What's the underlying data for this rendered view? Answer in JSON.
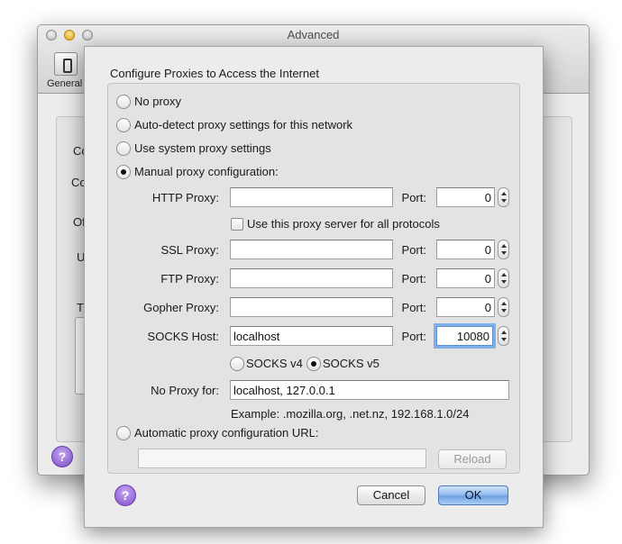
{
  "background_window": {
    "title": "Advanced",
    "toolbar_item_label": "General",
    "fragments": [
      "Co",
      "Co",
      "Of",
      "U",
      "T"
    ],
    "help_glyph": "?"
  },
  "dialog": {
    "title": "Configure Proxies to Access the Internet",
    "options": {
      "no_proxy": "No proxy",
      "auto_detect": "Auto-detect proxy settings for this network",
      "system": "Use system proxy settings",
      "manual": "Manual proxy configuration:",
      "auto_url": "Automatic proxy configuration URL:"
    },
    "selected_option": "manual",
    "http": {
      "label": "HTTP Proxy:",
      "value": "",
      "port_label": "Port:",
      "port": "0"
    },
    "use_for_all_label": "Use this proxy server for all protocols",
    "use_for_all_checked": false,
    "ssl": {
      "label": "SSL Proxy:",
      "value": "",
      "port_label": "Port:",
      "port": "0"
    },
    "ftp": {
      "label": "FTP Proxy:",
      "value": "",
      "port_label": "Port:",
      "port": "0"
    },
    "gopher": {
      "label": "Gopher Proxy:",
      "value": "",
      "port_label": "Port:",
      "port": "0"
    },
    "socks": {
      "label": "SOCKS Host:",
      "value": "localhost",
      "port_label": "Port:",
      "port": "10080"
    },
    "socks_versions": {
      "v4": "SOCKS v4",
      "v5": "SOCKS v5",
      "selected": "v5"
    },
    "no_proxy_for": {
      "label": "No Proxy for:",
      "value": "localhost, 127.0.0.1"
    },
    "example": "Example: .mozilla.org, .net.nz, 192.168.1.0/24",
    "auto_url_value": "",
    "reload_label": "Reload",
    "help_glyph": "?",
    "cancel_label": "Cancel",
    "ok_label": "OK"
  },
  "colors": {
    "default_button": "#8fb8ec",
    "focus_ring": "#7fb0ea",
    "help_button": "#7c4fc9"
  }
}
